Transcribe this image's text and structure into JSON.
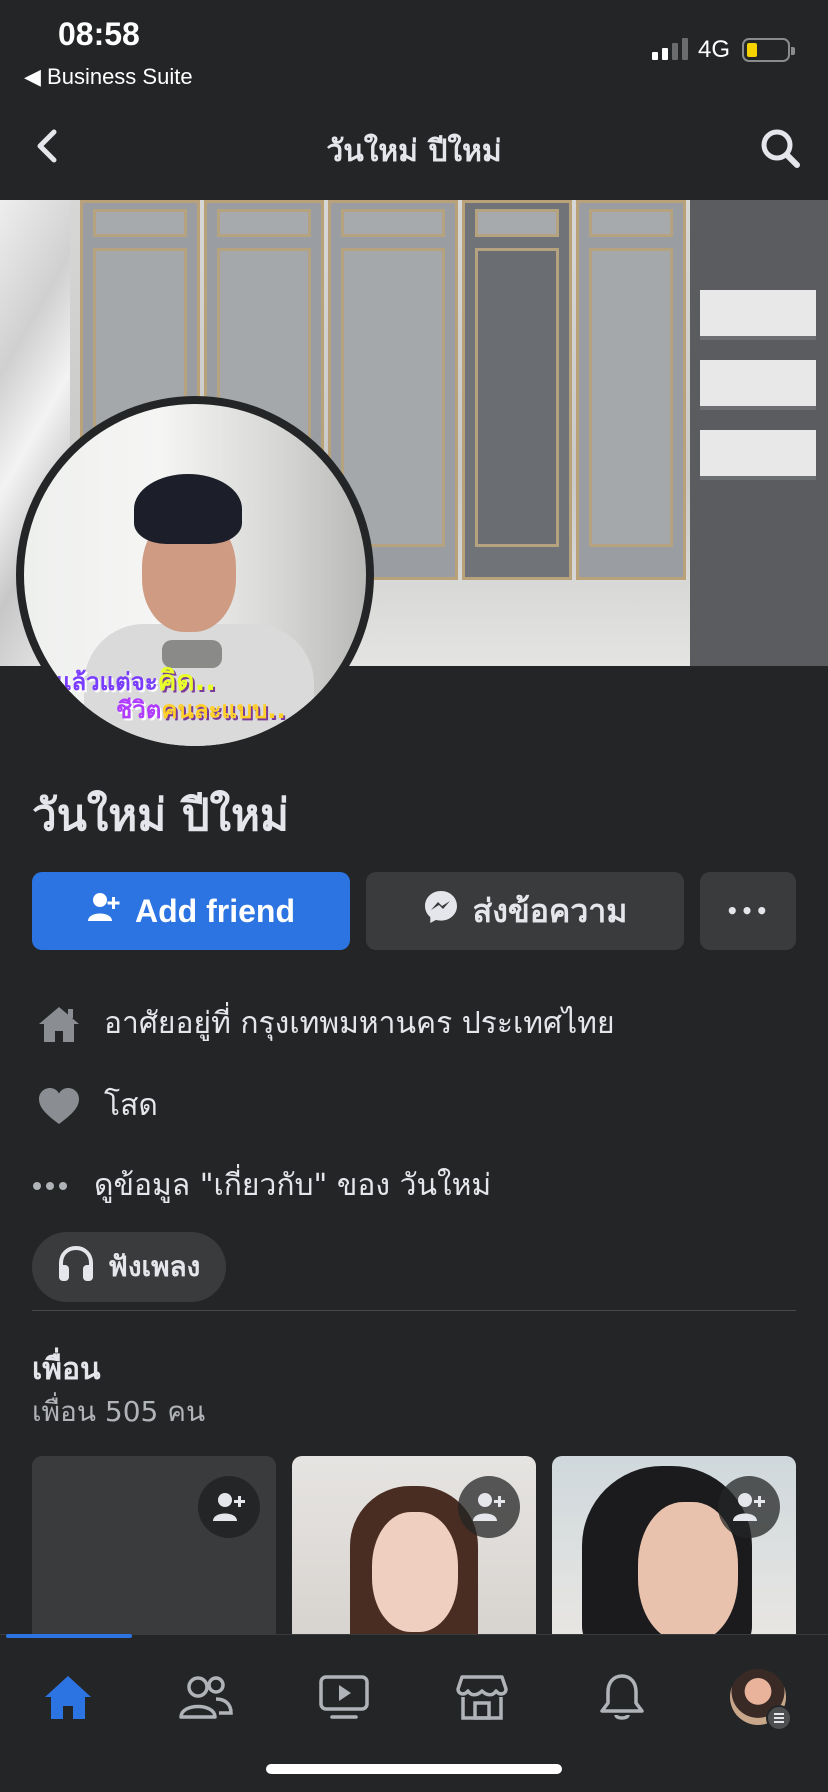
{
  "status_bar": {
    "time": "08:58",
    "back_app": "◀ Business Suite",
    "network": "4G"
  },
  "header": {
    "title": "วันใหม่ ปีใหม่"
  },
  "profile": {
    "name": "วันใหม่ ปีใหม่",
    "sticker_line1_a": "แล้ว",
    "sticker_line1_b": "แต่จะ",
    "sticker_line1_c": "คิด..",
    "sticker_line2_a": "ชีวิต",
    "sticker_line2_b": "คนละแบบ.."
  },
  "actions": {
    "add_friend": "Add friend",
    "message": "ส่งข้อความ",
    "more": "•••"
  },
  "intro": {
    "lives_in": "อาศัยอยู่ที่ กรุงเทพมหานคร ประเทศไทย",
    "relationship": "โสด",
    "see_about": "ดูข้อมูล \"เกี่ยวกับ\" ของ วันใหม่",
    "music_chip": "ฟังเพลง"
  },
  "friends": {
    "title": "เพื่อน",
    "count": "เพื่อน 505 คน"
  },
  "colors": {
    "background": "#242526",
    "accent": "#2d74e3",
    "secondary_button": "#3a3b3c"
  },
  "icons": {
    "back": "chevron-left-icon",
    "search": "search-icon",
    "add_friend": "person-add-icon",
    "messenger": "messenger-icon",
    "home_info": "house-icon",
    "relationship": "heart-icon",
    "more_info": "ellipsis-icon",
    "music": "headphones-icon",
    "nav": [
      "home-icon",
      "friends-icon",
      "watch-icon",
      "marketplace-icon",
      "notifications-icon",
      "profile-menu-icon"
    ]
  }
}
